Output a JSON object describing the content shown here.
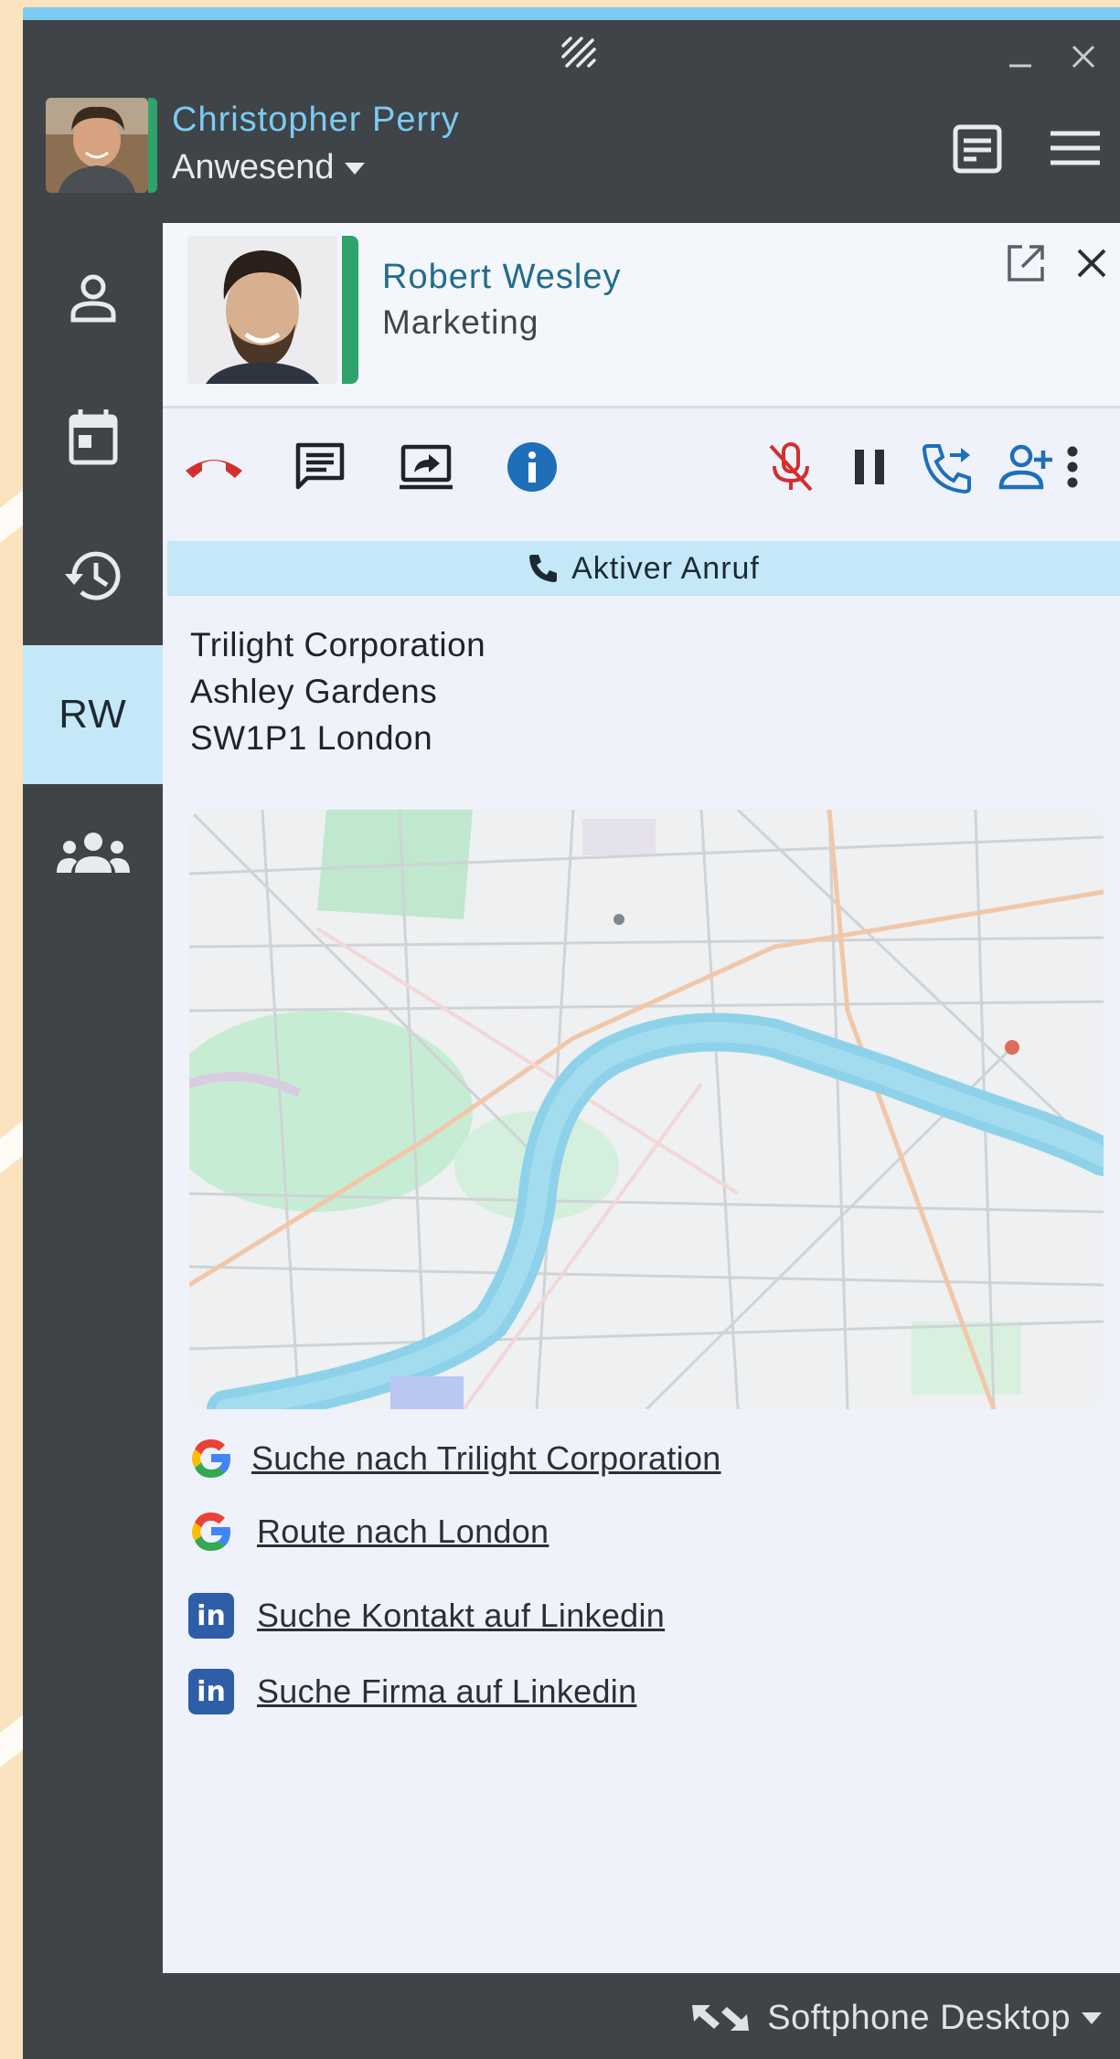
{
  "app": {
    "current_user": {
      "name": "Christopher Perry",
      "status": "Anwesend"
    },
    "window_buttons": [
      "minimize-icon",
      "close-icon"
    ],
    "header_actions": [
      "notes-icon",
      "menu-icon"
    ]
  },
  "sidebar": {
    "items": [
      {
        "name": "contacts",
        "icon": "person-icon"
      },
      {
        "name": "calendar",
        "icon": "calendar-icon"
      },
      {
        "name": "history",
        "icon": "history-icon"
      },
      {
        "name": "active-contact",
        "label": "RW"
      },
      {
        "name": "team",
        "icon": "group-icon"
      }
    ]
  },
  "contact": {
    "name": "Robert Wesley",
    "department": "Marketing"
  },
  "actions": [
    "hangup-icon",
    "chat-icon",
    "screen-share-icon",
    "info-icon",
    "mic-off-icon",
    "pause-icon",
    "call-transfer-icon",
    "add-person-icon",
    "more-vert-icon"
  ],
  "call_status": {
    "label": "Aktiver Anruf"
  },
  "address": {
    "line1": "Trilight Corporation",
    "line2": "Ashley Gardens",
    "line3": "SW1P1 London"
  },
  "links": [
    {
      "label": "Suche nach Trilight Corporation",
      "icon": "google-icon"
    },
    {
      "label": "Route nach London",
      "icon": "google-icon"
    },
    {
      "label": "Suche Kontakt auf Linkedin",
      "icon": "linkedin-icon"
    },
    {
      "label": "Suche Firma auf Linkedin",
      "icon": "linkedin-icon"
    }
  ],
  "linkedin_badge": "in",
  "footer": {
    "label": "Softphone Desktop"
  },
  "colors": {
    "accent": "#7ccbf3",
    "status_green": "#2fa36b",
    "hangup_red": "#d32f2f",
    "action_blue": "#1e6fb8",
    "active_bg": "#c5e8f8"
  }
}
